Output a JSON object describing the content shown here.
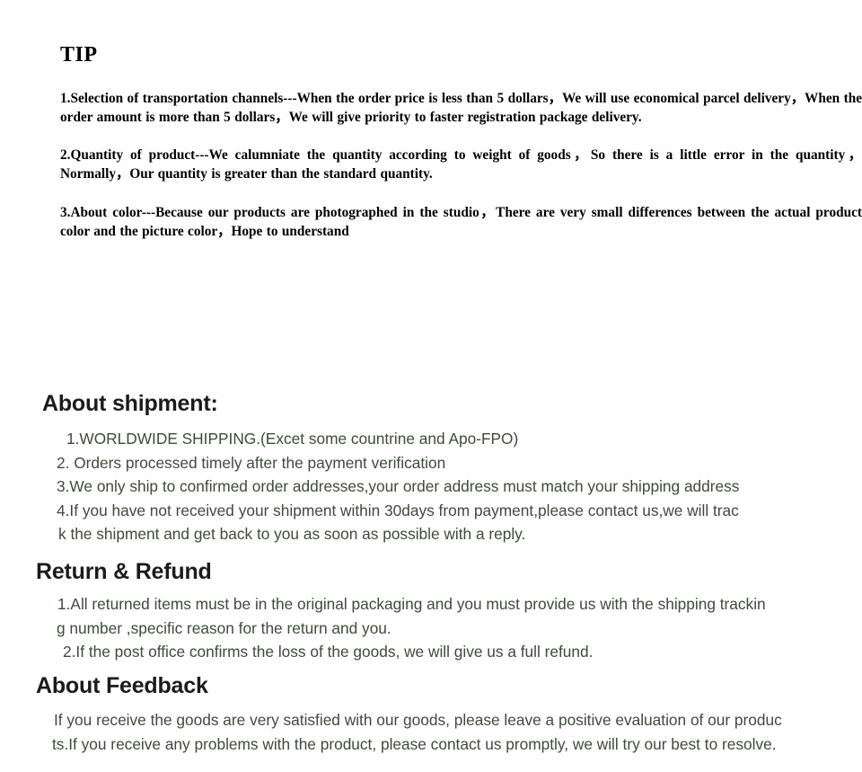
{
  "colors": {
    "background": "#ffffff",
    "tip_text": "#000000",
    "heading": "#1b1b1b",
    "body_text": "#3e4a3b"
  },
  "tip": {
    "title": "TIP",
    "paragraphs": [
      "1.Selection of transportation channels---When the order price is less than 5 dollars，We will use economical parcel delivery，When the order amount is more than 5 dollars，We will give priority to faster registration package delivery.",
      "2.Quantity of product---We calumniate the quantity according to weight of goods，So there is a little error in the quantity，Normally，Our quantity is greater than the standard quantity.",
      "3.About color---Because our products are photographed in the studio，There are very small differences between the actual product color and the picture color，Hope to understand"
    ]
  },
  "shipment": {
    "heading": "About shipment:",
    "lines": [
      "1.WORLDWIDE SHIPPING.(Excet some countrine and Apo-FPO)",
      "2. Orders processed timely after the payment verification",
      "3.We only ship to confirmed order addresses,your order address must match your shipping address",
      "4.If you have not received your shipment within 30days from payment,please contact us,we will trac",
      "k the shipment and get back to you as soon as possible with a reply."
    ]
  },
  "return_refund": {
    "heading": "Return & Refund",
    "lines": [
      "1.All returned items must be in the original packaging and you must provide us with the shipping trackin",
      "g number ,specific reason for the return and you.",
      "2.If the post office confirms the loss of the goods, we will give us a full refund."
    ]
  },
  "feedback": {
    "heading": "About Feedback",
    "lines": [
      "If you receive the goods are very satisfied with our goods, please leave a positive evaluation of our produc",
      "ts.If you receive any problems with the product, please contact us promptly, we will try our best to resolve."
    ]
  }
}
